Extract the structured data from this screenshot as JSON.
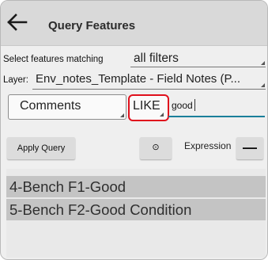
{
  "header": {
    "title": "Query Features",
    "back_icon": "arrow-left-icon"
  },
  "match": {
    "label": "Select features matching",
    "value": "all filters"
  },
  "layer": {
    "label": "Layer:",
    "value": "Env_notes_Template - Field Notes (P..."
  },
  "query": {
    "field": "Comments",
    "operator": "LIKE",
    "value": "good"
  },
  "actions": {
    "apply_label": "Apply Query",
    "radio_glyph": "⊙",
    "expression_label": "Expression",
    "remove_label": "—"
  },
  "results": [
    "4-Bench F1-Good",
    "5-Bench F2-Good Condition"
  ],
  "colors": {
    "header_bg": "#d9d9d9",
    "operator_highlight": "#e0101c",
    "result_row_bg": "#c4c4c4",
    "button_bg": "#dcdcdc"
  }
}
